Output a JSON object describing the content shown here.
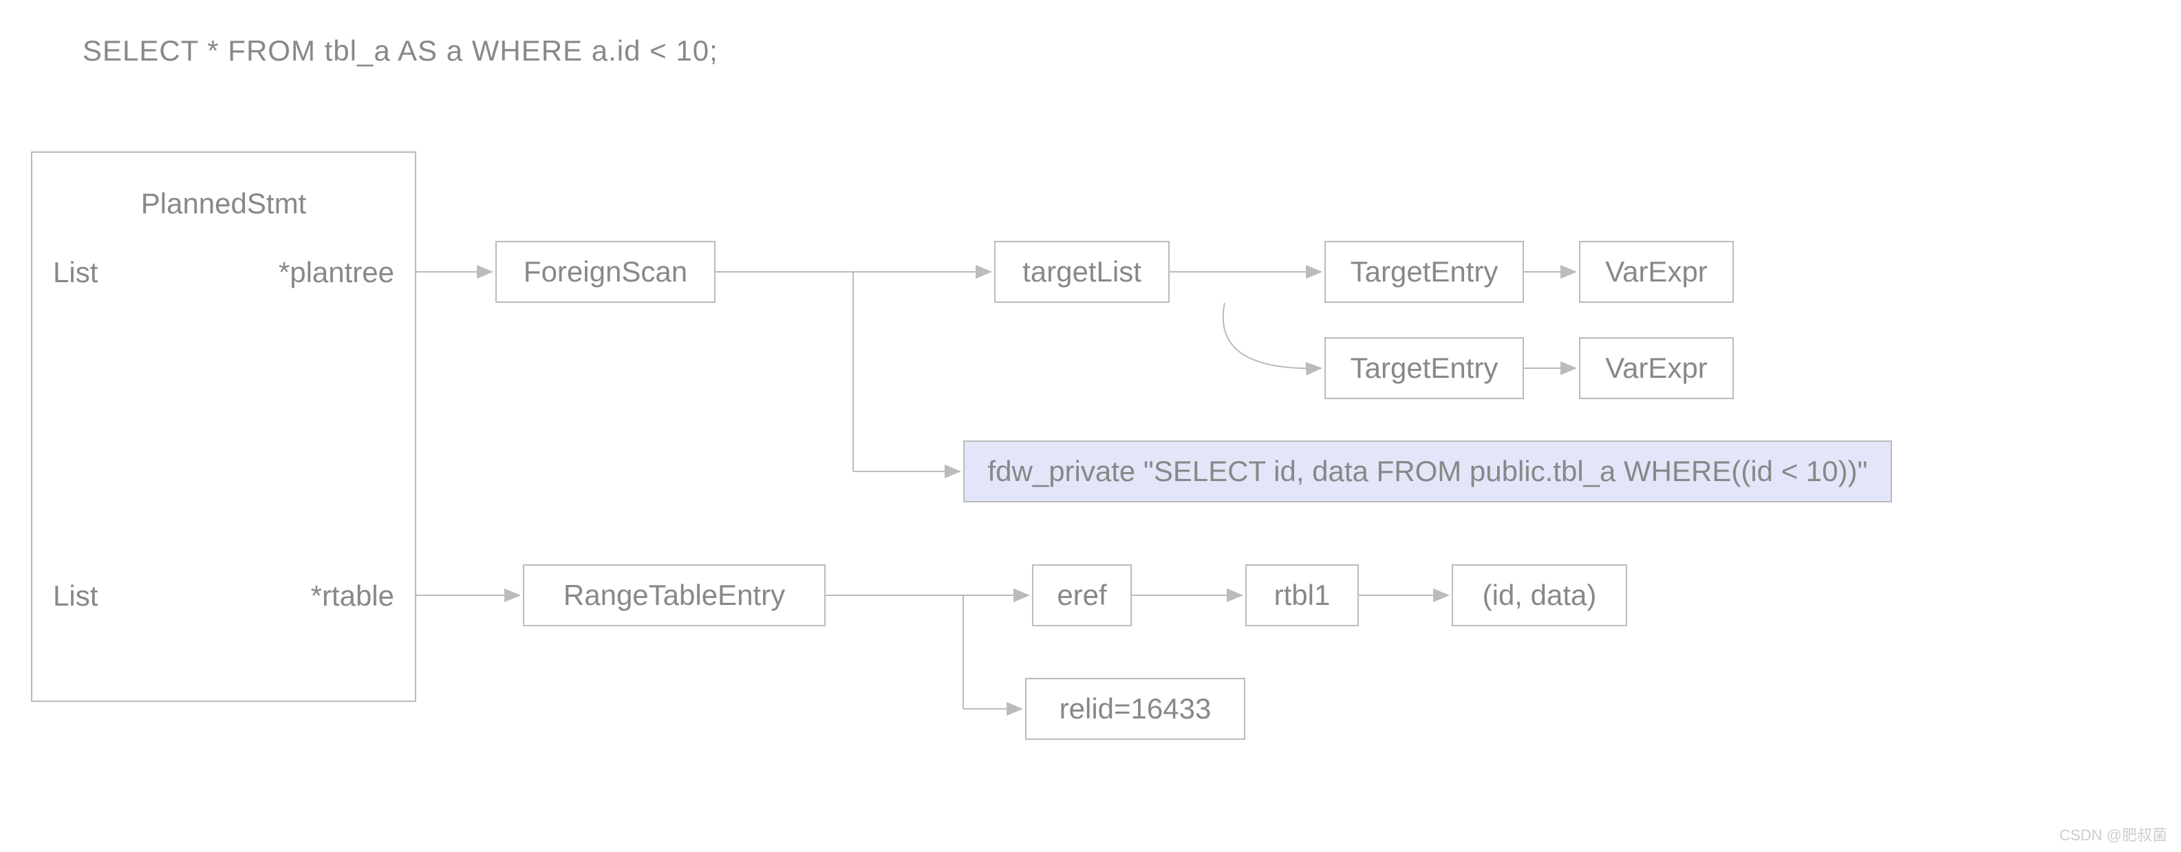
{
  "query": "SELECT * FROM tbl_a AS a WHERE a.id < 10;",
  "struct": {
    "title": "PlannedStmt",
    "row1_type": "List",
    "row1_field": "*plantree",
    "row2_type": "List",
    "row2_field": "*rtable"
  },
  "nodes": {
    "foreignscan": "ForeignScan",
    "targetlist": "targetList",
    "targetentry1": "TargetEntry",
    "varexpr1": "VarExpr",
    "targetentry2": "TargetEntry",
    "varexpr2": "VarExpr",
    "fdw_private": "fdw_private \"SELECT id, data FROM public.tbl_a WHERE((id < 10))\"",
    "rangetableentry": "RangeTableEntry",
    "eref": "eref",
    "rtbl1": "rtbl1",
    "id_data": "(id, data)",
    "relid": "relid=16433"
  },
  "watermark": "CSDN @肥叔菌"
}
